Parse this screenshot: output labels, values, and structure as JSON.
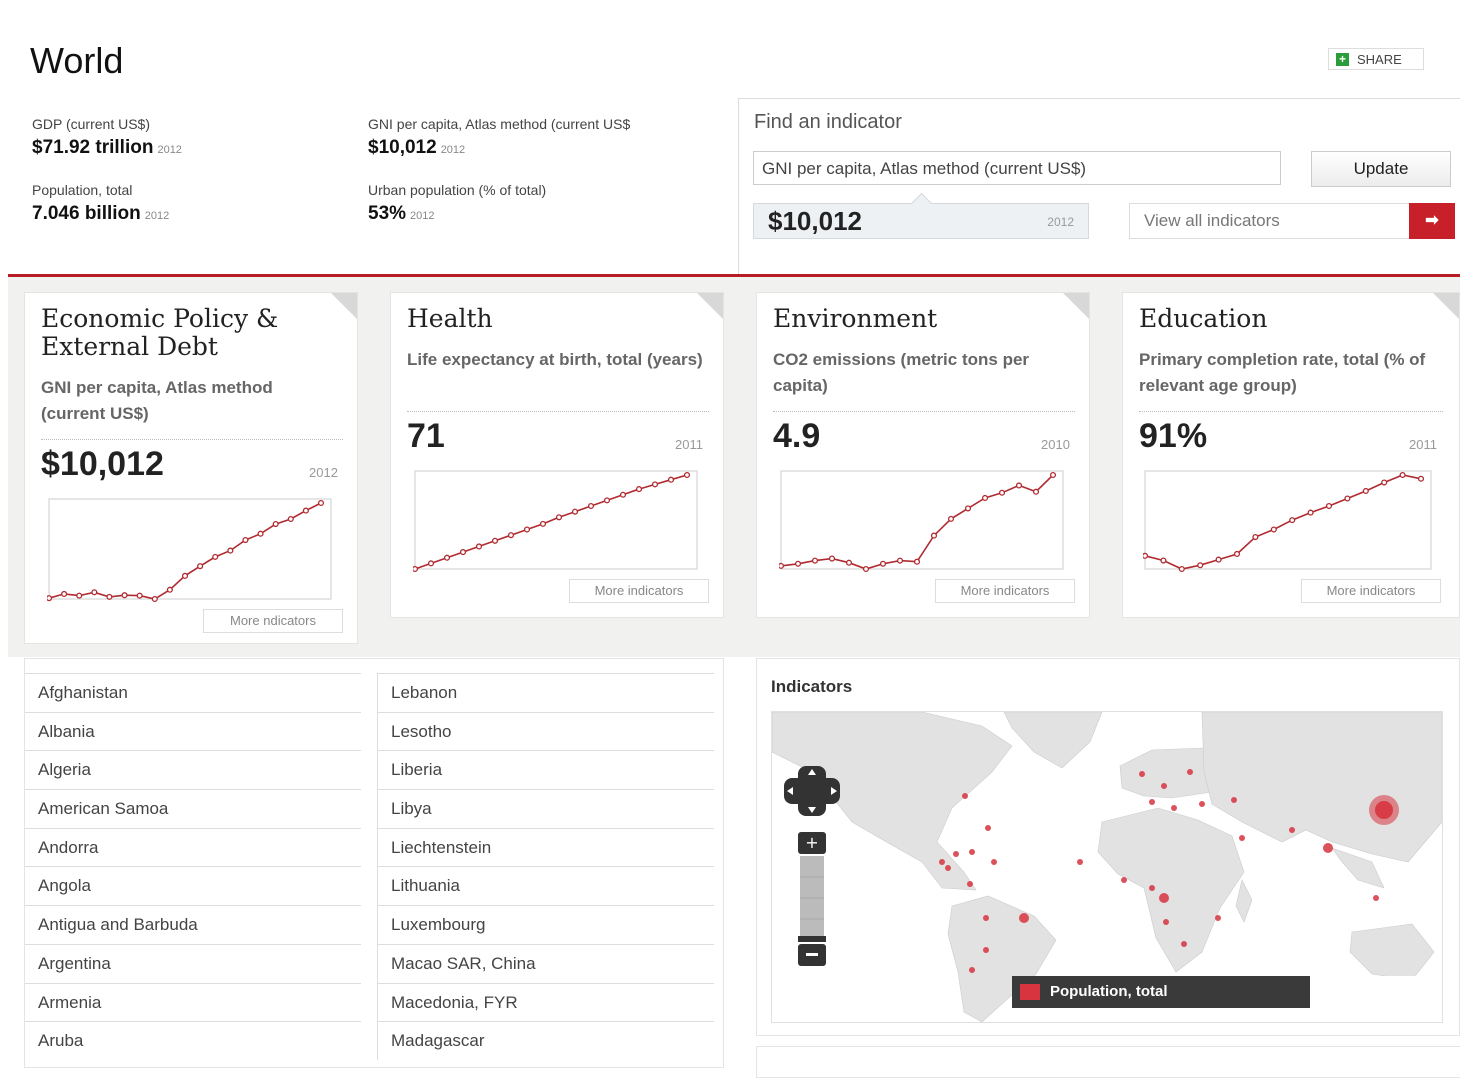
{
  "header": {
    "title": "World",
    "share_label": "SHARE",
    "stats": [
      {
        "label": "GDP (current US$)",
        "value": "$71.92 trillion",
        "year": "2012"
      },
      {
        "label": "Population, total",
        "value": "7.046 billion",
        "year": "2012"
      },
      {
        "label": "GNI per capita, Atlas method (current US$",
        "value": "$10,012",
        "year": "2012"
      },
      {
        "label": "Urban population (% of total)",
        "value": "53%",
        "year": "2012"
      }
    ]
  },
  "finder": {
    "title": "Find an indicator",
    "input_value": "GNI per capita, Atlas method (current US$)",
    "update_label": "Update",
    "result_value": "$10,012",
    "result_year": "2012",
    "view_all_label": "View all indicators",
    "arrow_icon": "arrow-right-icon"
  },
  "cards": [
    {
      "title": "Economic Policy & External Debt",
      "indicator": "GNI per capita, Atlas method (current US$)",
      "value": "$10,012",
      "year": "2012",
      "more": "More ndicators",
      "series": [
        2,
        12,
        8,
        16,
        5,
        9,
        8,
        0,
        22,
        55,
        78,
        100,
        115,
        140,
        155,
        178,
        190,
        210,
        228
      ]
    },
    {
      "title": "Health",
      "indicator": "Life expectancy at birth, total (years)",
      "value": "71",
      "year": "2011",
      "more": "More indicators",
      "series": [
        0,
        6,
        12,
        18,
        24,
        30,
        36,
        42,
        48,
        55,
        61,
        67,
        73,
        79,
        85,
        90,
        95,
        100
      ]
    },
    {
      "title": "Environment",
      "indicator": "CO2 emissions (metric tons per capita)",
      "value": "4.9",
      "year": "2010",
      "more": "More indicators",
      "series": [
        3,
        5,
        8,
        10,
        6,
        0,
        5,
        8,
        7,
        32,
        48,
        58,
        68,
        73,
        80,
        74,
        90
      ]
    },
    {
      "title": "Education",
      "indicator": "Primary completion rate, total (% of relevant age group)",
      "value": "91%",
      "year": "2011",
      "more": "More indicators",
      "series": [
        14,
        9,
        0,
        4,
        10,
        16,
        34,
        42,
        52,
        60,
        67,
        75,
        83,
        92,
        100,
        96
      ]
    }
  ],
  "countries_left": [
    "Afghanistan",
    "Albania",
    "Algeria",
    "American Samoa",
    "Andorra",
    "Angola",
    "Antigua and Barbuda",
    "Argentina",
    "Armenia",
    "Aruba"
  ],
  "countries_right": [
    "Lebanon",
    "Lesotho",
    "Liberia",
    "Libya",
    "Liechtenstein",
    "Lithuania",
    "Luxembourg",
    "Macao SAR, China",
    "Macedonia, FYR",
    "Madagascar"
  ],
  "map": {
    "title": "Indicators",
    "legend_label": "Population, total",
    "legend_color": "#d7343f"
  }
}
